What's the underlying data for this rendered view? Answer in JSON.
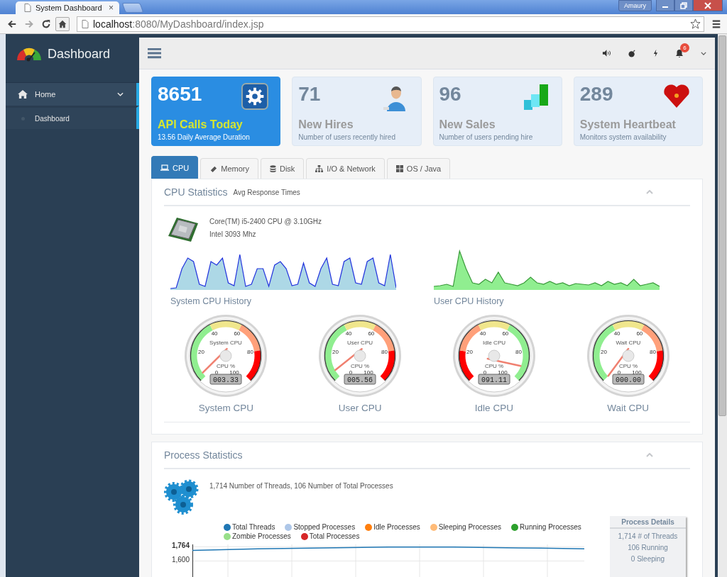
{
  "browser": {
    "tab_title": "System Dashboard",
    "tab_close": "×",
    "user": "Amaury",
    "url_host": "localhost",
    "url_rest": ":8080/MyDashboard/index.jsp"
  },
  "sidebar": {
    "brand": "Dashboard",
    "items": [
      {
        "label": "Home",
        "expanded": true,
        "selected": true,
        "children": [
          {
            "label": "Dashboard",
            "selected": false
          }
        ]
      }
    ]
  },
  "topbar": {
    "notification_count": "6"
  },
  "cards": [
    {
      "value": "8651",
      "title": "API Calls Today",
      "subtitle": "13.56 Daily Average Duration",
      "highlighted": true,
      "kind": "gear"
    },
    {
      "value": "71",
      "title": "New Hires",
      "subtitle": "Number of users recently hired",
      "highlighted": false,
      "kind": "person"
    },
    {
      "value": "96",
      "title": "New Sales",
      "subtitle": "Number of users pending hire",
      "highlighted": false,
      "kind": "bars"
    },
    {
      "value": "289",
      "title": "System Heartbeat",
      "subtitle": "Monitors system availability",
      "highlighted": false,
      "kind": "heart"
    }
  ],
  "tabs": [
    {
      "label": "CPU",
      "kind": "laptop",
      "selected": true
    },
    {
      "label": "Memory",
      "kind": "memory",
      "selected": false
    },
    {
      "label": "Disk",
      "kind": "database",
      "selected": false
    },
    {
      "label": "I/O & Network",
      "kind": "network",
      "selected": false
    },
    {
      "label": "OS / Java",
      "kind": "windows",
      "selected": false
    }
  ],
  "cpu_panel": {
    "title": "CPU Statistics",
    "subtitle": "Avg Response Times",
    "cpu_model": "Core(TM) i5-2400 CPU @ 3.10GHz",
    "cpu_speed": "Intel 3093 Mhz",
    "histories": [
      {
        "label": "System CPU History",
        "kind": "system"
      },
      {
        "label": "User CPU History",
        "kind": "user"
      }
    ],
    "gauges": [
      {
        "label": "System CPU",
        "inner_label": "System CPU",
        "unit": "CPU %",
        "reading": "003.33",
        "kind": "usage",
        "scale": [
          "0",
          "20",
          "40",
          "60",
          "80",
          "100"
        ]
      },
      {
        "label": "User CPU",
        "inner_label": "User CPU",
        "unit": "CPU %",
        "reading": "005.56",
        "kind": "usage",
        "scale": [
          "0",
          "20",
          "40",
          "60",
          "80",
          "100"
        ]
      },
      {
        "label": "Idle CPU",
        "inner_label": "Idle CPU",
        "unit": "CPU %",
        "reading": "091.11",
        "kind": "idle",
        "scale": [
          "0",
          "20",
          "40",
          "60",
          "80",
          "100"
        ]
      },
      {
        "label": "Wait CPU",
        "inner_label": "Wait CPU",
        "unit": "CPU %",
        "reading": "000.00",
        "kind": "usage",
        "scale": [
          "0",
          "20",
          "40",
          "60",
          "80",
          "100"
        ]
      }
    ]
  },
  "process_panel": {
    "title": "Process Statistics",
    "summary": "1,714 Number of Threads, 106 Number of Total Processes",
    "chart_data": {
      "type": "line",
      "ylim": [
        1400,
        1790
      ],
      "yticks": [
        {
          "value": 1764,
          "label": "1,764"
        },
        {
          "value": 1600,
          "label": "1,600"
        }
      ],
      "series": [
        {
          "name": "Total Threads",
          "color": "#1f77b4",
          "values": [
            1720,
            1740,
            1750,
            1760,
            1760,
            1750,
            1740
          ]
        },
        {
          "name": "Stopped Processes",
          "color": "#aec7e8",
          "values": [
            null,
            null,
            null,
            null,
            null,
            null,
            null
          ]
        },
        {
          "name": "Idle Processes",
          "color": "#ff7f0e",
          "values": [
            null,
            null,
            null,
            null,
            null,
            null,
            null
          ]
        },
        {
          "name": "Sleeping Processes",
          "color": "#ffbb78",
          "values": [
            null,
            null,
            null,
            null,
            null,
            null,
            null
          ]
        },
        {
          "name": "Running Processes",
          "color": "#2ca02c",
          "values": [
            null,
            null,
            null,
            null,
            null,
            null,
            null
          ]
        },
        {
          "name": "Zombie Processes",
          "color": "#98df8a",
          "values": [
            null,
            null,
            null,
            null,
            null,
            null,
            null
          ]
        },
        {
          "name": "Total Processes",
          "color": "#d62728",
          "values": [
            null,
            null,
            null,
            null,
            null,
            null,
            null
          ]
        }
      ]
    },
    "details": {
      "title": "Process Details",
      "lines": [
        "1,714 # of Threads",
        "106 Running",
        "0 Sleeping"
      ]
    }
  }
}
